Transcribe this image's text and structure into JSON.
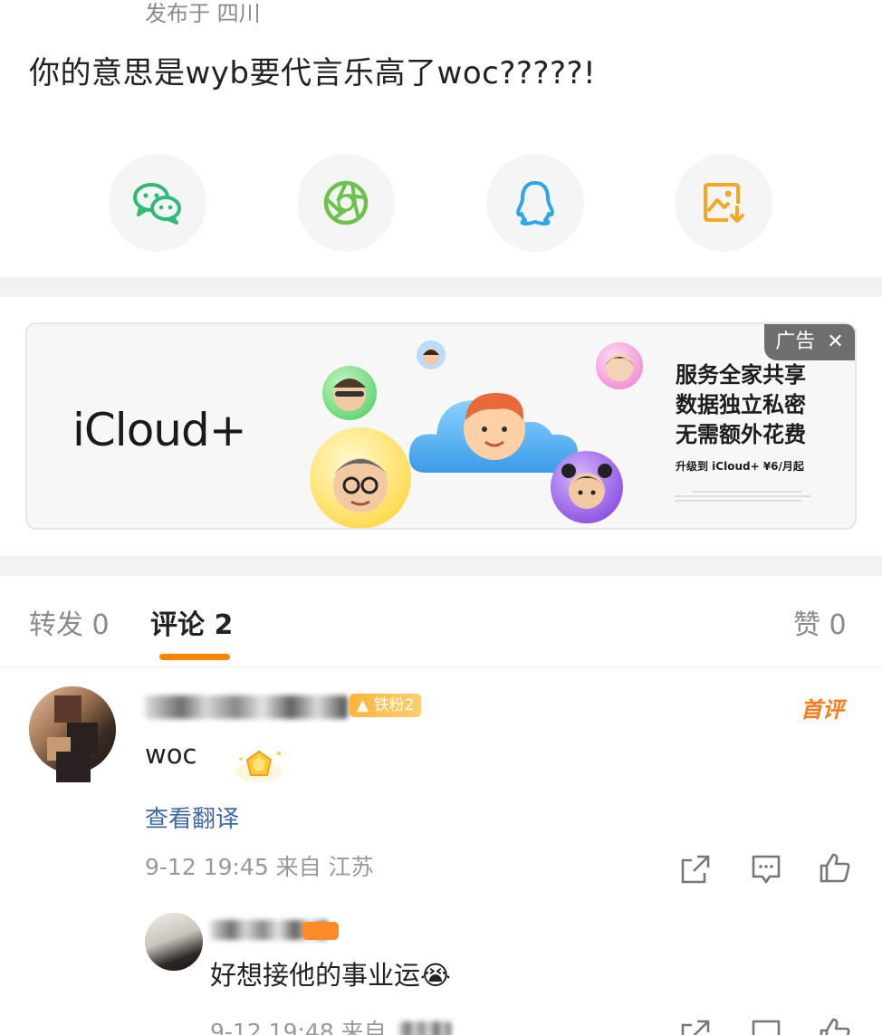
{
  "post": {
    "location": "发布于 四川",
    "text": "你的意思是wyb要代言乐高了woc?????!"
  },
  "share": {
    "items": [
      {
        "icon": "wechat-icon",
        "color": "#2dbb78"
      },
      {
        "icon": "moments-icon",
        "color": "#6cc24a"
      },
      {
        "icon": "qq-icon",
        "color": "#2aa7e6"
      },
      {
        "icon": "save-image-icon",
        "color": "#f5a623"
      }
    ]
  },
  "ad": {
    "brand": "iCloud+",
    "tag": "广告",
    "close": "✕",
    "lines": [
      "服务全家共享",
      "数据独立私密",
      "无需额外花费"
    ],
    "price": "升级到 iCloud+ ¥6/月起"
  },
  "tabs": {
    "repost": "转发 0",
    "comments": "评论 2",
    "likes": "赞 0"
  },
  "comments": [
    {
      "fan_badge": "铁粉2",
      "first_tag": "首评",
      "text": "woc",
      "translate": "查看翻译",
      "meta": "9-12 19:45 来自 江苏"
    },
    {
      "text": "好想接他的事业运",
      "emoji": "😭",
      "meta": "9-12 19:48 来自"
    }
  ],
  "colors": {
    "accent": "#ff8200",
    "link": "#3f6aa4"
  }
}
